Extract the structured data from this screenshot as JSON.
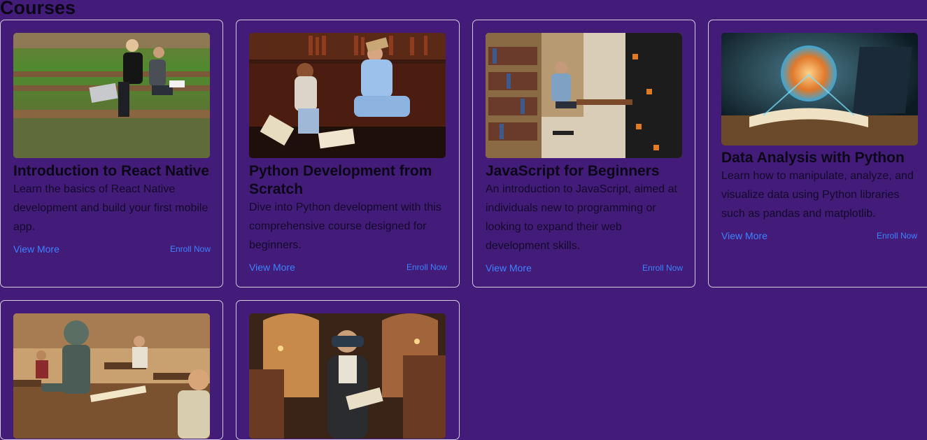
{
  "page": {
    "title": "Courses"
  },
  "courses": [
    {
      "title": "Introduction to React Native",
      "description": "Learn the basics of React Native development and build your first mobile app.",
      "view_more": "View More",
      "enroll": "Enroll Now",
      "image": "two students with laptop on park bench"
    },
    {
      "title": "Python Development from Scratch",
      "description": "Dive into Python development with this comprehensive course designed for beginners.",
      "view_more": "View More",
      "enroll": "Enroll Now",
      "image": "two students sitting on floor laughing with books"
    },
    {
      "title": "JavaScript for Beginners",
      "description": "An introduction to JavaScript, aimed at individuals new to programming or looking to expand their web development skills.",
      "view_more": "View More",
      "enroll": "Enroll Now",
      "image": "person studying at desk in library"
    },
    {
      "title": "Data Analysis with Python",
      "description": "Learn how to manipulate, analyze, and visualize data using Python libraries such as pandas and matplotlib.",
      "view_more": "View More",
      "enroll": "Enroll Now",
      "image": "glowing globe above open book and laptop"
    },
    {
      "title": "",
      "description": "",
      "view_more": "",
      "enroll": "",
      "image": "robot sitting in classroom with children"
    },
    {
      "title": "",
      "description": "",
      "view_more": "",
      "enroll": "",
      "image": "boy with VR headset holding book in library"
    }
  ],
  "colors": {
    "background": "#431c79",
    "card_border": "#d4cce4",
    "link": "#3b82ff",
    "text": "#0b0717"
  }
}
